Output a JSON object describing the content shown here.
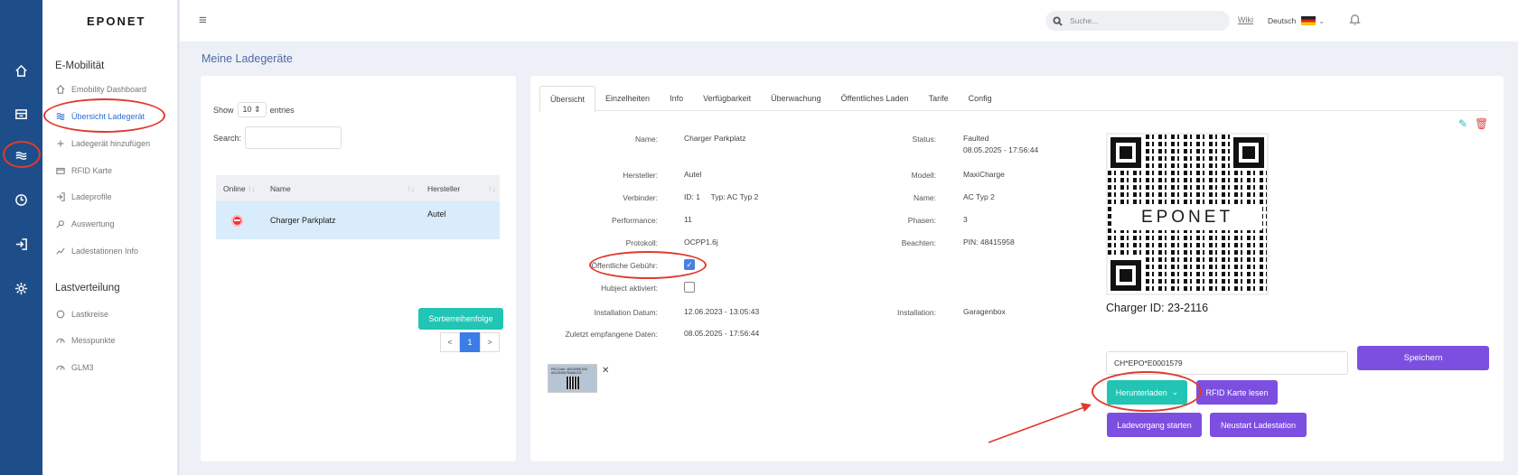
{
  "brand": "EPONET",
  "topbar": {
    "search_placeholder": "Suche...",
    "wiki": "Wiki",
    "language": "Deutsch"
  },
  "sidebar": {
    "section1": "E-Mobilität",
    "items1": [
      {
        "label": "Emobility Dashboard",
        "icon": "home-icon"
      },
      {
        "label": "Übersicht Ladegerät",
        "icon": "waves-icon",
        "active": true
      },
      {
        "label": "Ladegerät hinzufügen",
        "icon": "plus-icon"
      },
      {
        "label": "RFID Karte",
        "icon": "card-icon"
      },
      {
        "label": "Ladeprofile",
        "icon": "login-icon"
      },
      {
        "label": "Auswertung",
        "icon": "magnifier-icon"
      },
      {
        "label": "Ladestationen Info",
        "icon": "chart-icon"
      }
    ],
    "section2": "Lastverteilung",
    "items2": [
      {
        "label": "Lastkreise",
        "icon": "circle-icon"
      },
      {
        "label": "Messpunkte",
        "icon": "gauge-icon"
      },
      {
        "label": "GLM3",
        "icon": "gauge-icon"
      }
    ]
  },
  "page_title": "Meine Ladegeräte",
  "list": {
    "show": "Show",
    "entries_value": "10",
    "entries": "entries",
    "search": "Search:",
    "columns": [
      "Online",
      "Name",
      "Hersteller"
    ],
    "rows": [
      {
        "name": "Charger Parkplatz",
        "manufacturer": "Autel"
      }
    ],
    "pager": {
      "prev": "<",
      "page": "1",
      "next": ">"
    },
    "sort_button": "Sortierreihenfolge"
  },
  "tabs": [
    "Übersicht",
    "Einzelheiten",
    "Info",
    "Verfügbarkeit",
    "Überwachung",
    "Öffentliches Laden",
    "Tarife",
    "Config"
  ],
  "detail": {
    "name_l": "Name:",
    "name_v": "Charger Parkplatz",
    "hersteller_l": "Hersteller:",
    "hersteller_v": "Autel",
    "verbinder_l": "Verbinder:",
    "verbinder_v": "ID: 1     Typ: AC Typ 2",
    "performance_l": "Performance:",
    "performance_v": "11",
    "protokoll_l": "Protokoll:",
    "protokoll_v": "OCPP1.6j",
    "gebuehr_l": "Öffentliche Gebühr:",
    "gebuehr_checked": true,
    "hubject_l": "Hubject aktiviert:",
    "hubject_checked": false,
    "install_datum_l": "Installation Datum:",
    "install_datum_v": "12.06.2023 - 13:05:43",
    "zuletzt_l": "Zuletzt empfangene Daten:",
    "zuletzt_v": "08.05.2025 - 17:56:44",
    "status_l": "Status:",
    "status_v1": "Faulted",
    "status_v2": "08.05.2025 - 17:56:44",
    "modell_l": "Modell:",
    "modell_v": "MaxiCharge",
    "name2_l": "Name:",
    "name2_v": "AC Typ 2",
    "phasen_l": "Phasen:",
    "phasen_v": "3",
    "beachten_l": "Beachten:",
    "beachten_v": "PIN: 48415958",
    "installation_l": "Installation:",
    "installation_v": "Garagenbox",
    "thumb_text": "PIN Code: 48415958 S/N: A0123456789ABCDE"
  },
  "qr": {
    "logo": "EPONET",
    "charger_id": "Charger ID: 23-2116"
  },
  "evse_input": "CH*EPO*E0001579",
  "buttons": {
    "save": "Speichern",
    "download": "Herunterladen",
    "rfid": "RFID Karte lesen",
    "start": "Ladevorgang starten",
    "restart": "Neustart Ladestation"
  }
}
